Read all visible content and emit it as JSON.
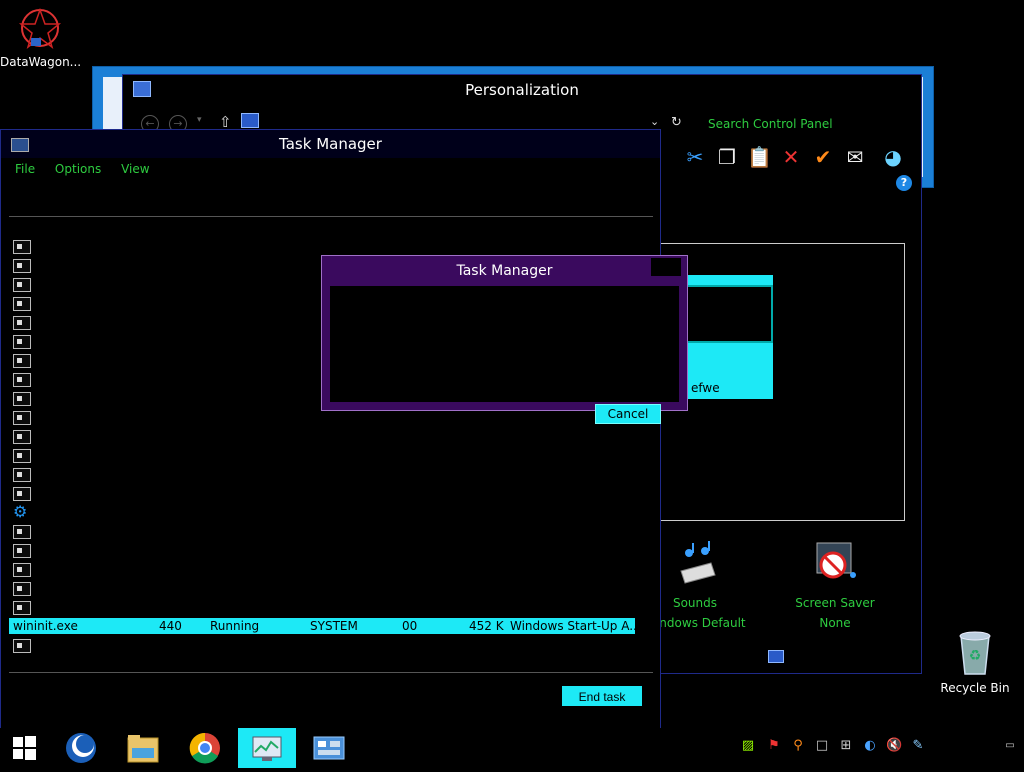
{
  "desktop": {
    "icon1_label": "DataWagon...",
    "recycle_label": "Recycle Bin"
  },
  "personalization": {
    "title": "Personalization",
    "search_label": "Search Control Panel",
    "theme_label": "efwe",
    "sounds": {
      "name": "Sounds",
      "value": "Windows Default"
    },
    "screen_saver": {
      "name": "Screen Saver",
      "value": "None"
    }
  },
  "taskmgr": {
    "title": "Task Manager",
    "menu": {
      "file": "File",
      "options": "Options",
      "view": "View"
    },
    "selected_row": {
      "name": "wininit.exe",
      "pid": "440",
      "status": "Running",
      "user": "SYSTEM",
      "cpu": "00",
      "memory": "452 K",
      "description": "Windows Start-Up A..."
    },
    "end_task_label": "End task"
  },
  "dialog": {
    "title": "Task Manager",
    "cancel_label": "Cancel"
  },
  "colors": {
    "accent": "#1de9f6",
    "text_green": "#2ecc40",
    "dialog_purple": "#3a0a5e"
  }
}
